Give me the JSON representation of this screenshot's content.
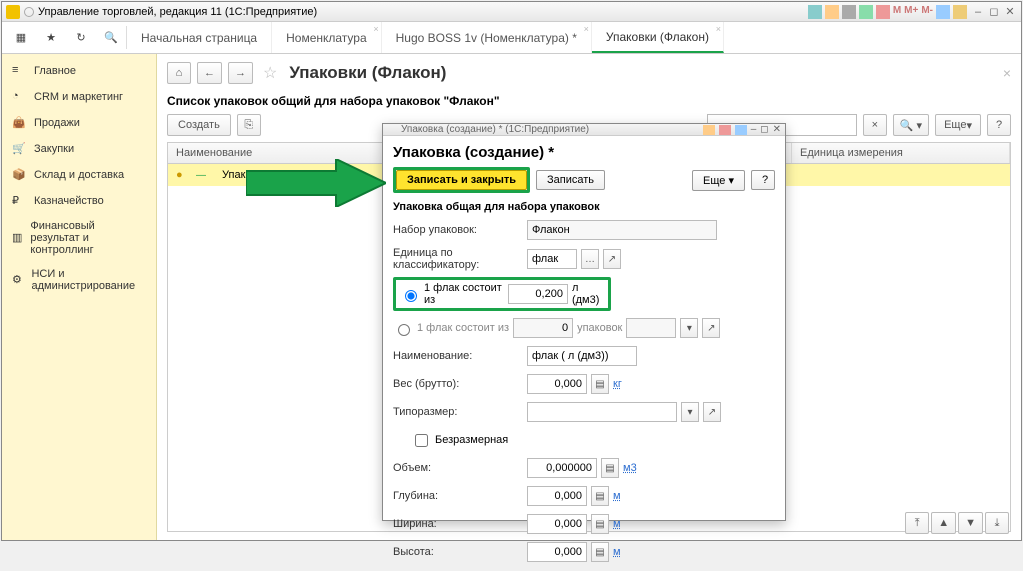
{
  "titlebar": {
    "title": "Управление торговлей, редакция 11  (1С:Предприятие)"
  },
  "tabs": [
    {
      "label": "Начальная страница"
    },
    {
      "label": "Номенклатура"
    },
    {
      "label": "Hugo BOSS 1v (Номенклатура) *"
    },
    {
      "label": "Упаковки (Флакон)",
      "active": true
    }
  ],
  "sidebar": {
    "items": [
      {
        "label": "Главное"
      },
      {
        "label": "CRM и маркетинг"
      },
      {
        "label": "Продажи"
      },
      {
        "label": "Закупки"
      },
      {
        "label": "Склад и доставка"
      },
      {
        "label": "Казначейство"
      },
      {
        "label": "Финансовый результат и контроллинг"
      },
      {
        "label": "НСИ и администрирование"
      }
    ]
  },
  "page": {
    "title": "Упаковки (Флакон)",
    "subtitle": "Список упаковок общий для набора упаковок \"Флакон\"",
    "create_label": "Создать",
    "more_label": "Еще",
    "columns": {
      "name": "Наименование",
      "unit": "Единица измерения"
    },
    "row": {
      "name": "Упаковк"
    }
  },
  "dialog": {
    "wintitle": "Упаковка (создание) *  (1С:Предприятие)",
    "title": "Упаковка (создание) *",
    "save_close": "Записать и закрыть",
    "save": "Записать",
    "more": "Еще",
    "section": "Упаковка общая для набора упаковок",
    "set_label": "Набор упаковок:",
    "set_value": "Флакон",
    "classifier_label": "Единица по классификатору:",
    "classifier_value": "флак",
    "consist1_label": "1 флак состоит из",
    "consist1_value": "0,200",
    "consist1_unit": "л (дм3)",
    "consist2_label": "1 флак состоит из",
    "consist2_value": "0",
    "consist2_unit": "упаковок",
    "name_label": "Наименование:",
    "name_value": "флак ( л (дм3))",
    "weight_label": "Вес (брутто):",
    "weight_value": "0,000",
    "weight_unit": "кг",
    "typesize_label": "Типоразмер:",
    "dimless_label": "Безразмерная",
    "volume_label": "Объем:",
    "volume_value": "0,000000",
    "volume_unit": "м3",
    "depth_label": "Глубина:",
    "depth_value": "0,000",
    "depth_unit": "м",
    "width_label": "Ширина:",
    "width_value": "0,000",
    "width_unit": "м",
    "height_label": "Высота:",
    "height_value": "0,000",
    "height_unit": "м"
  }
}
